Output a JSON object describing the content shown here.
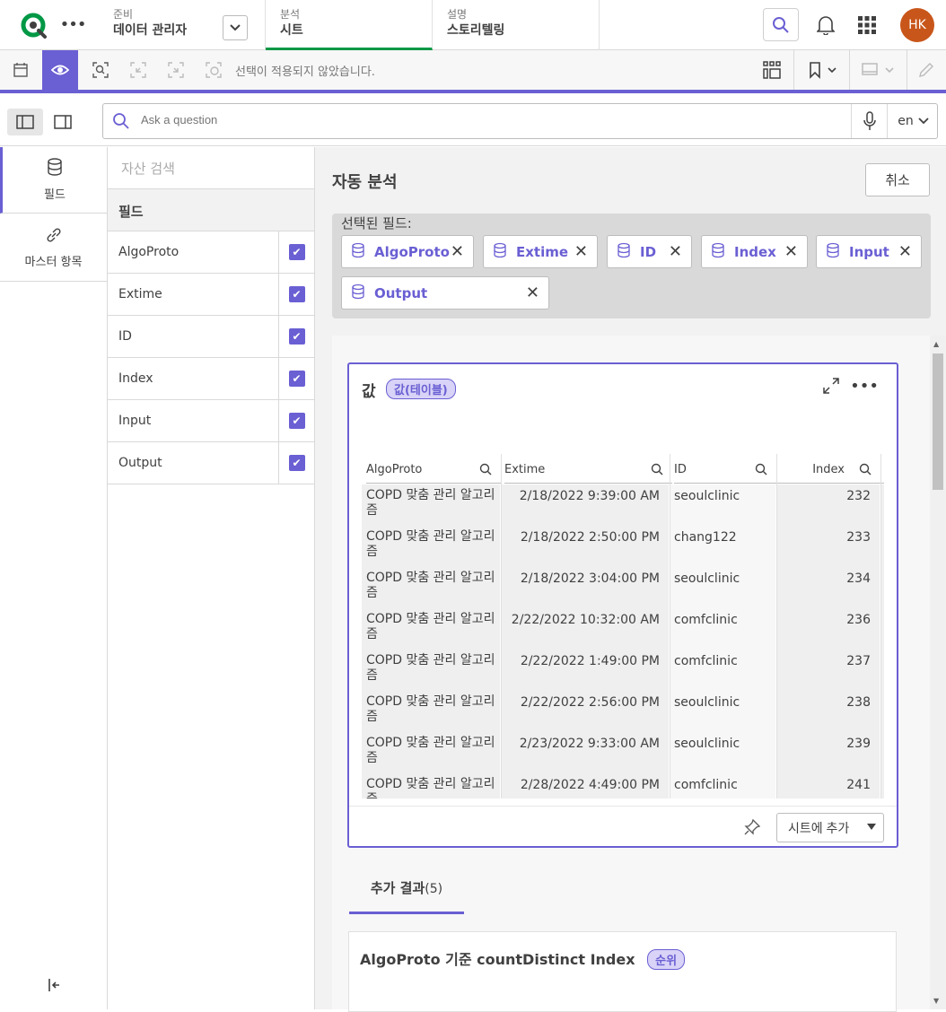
{
  "topnav": {
    "prep_small": "준비",
    "prep_big": "데이터 관리자",
    "analysis_small": "분석",
    "analysis_big": "시트",
    "story_small": "설명",
    "story_big": "스토리텔링",
    "avatar_initials": "HK"
  },
  "toolbar": {
    "selection_message": "선택이 적용되지 않았습니다."
  },
  "question": {
    "placeholder": "Ask a question",
    "language": "en"
  },
  "rail": {
    "fields_label": "필드",
    "master_label": "마스터 항목"
  },
  "fields_panel": {
    "search_placeholder": "자산 검색",
    "header": "필드",
    "fields": [
      "AlgoProto",
      "Extime",
      "ID",
      "Index",
      "Input",
      "Output"
    ]
  },
  "main": {
    "title": "자동 분석",
    "cancel_label": "취소",
    "selected_label": "선택된 필드:",
    "chips": [
      "AlgoProto",
      "Extime",
      "ID",
      "Index",
      "Input",
      "Output"
    ]
  },
  "card": {
    "title": "값",
    "badge": "값(테이블)",
    "columns": [
      "AlgoProto",
      "Extime",
      "ID",
      "Index"
    ],
    "rows": [
      [
        "COPD 맞춤 관리 알고리즘",
        "2/18/2022 9:39:00 AM",
        "seoulclinic",
        "232"
      ],
      [
        "COPD 맞춤 관리 알고리즘",
        "2/18/2022 2:50:00 PM",
        "chang122",
        "233"
      ],
      [
        "COPD 맞춤 관리 알고리즘",
        "2/18/2022 3:04:00 PM",
        "seoulclinic",
        "234"
      ],
      [
        "COPD 맞춤 관리 알고리즘",
        "2/22/2022 10:32:00 AM",
        "comfclinic",
        "236"
      ],
      [
        "COPD 맞춤 관리 알고리즘",
        "2/22/2022 1:49:00 PM",
        "comfclinic",
        "237"
      ],
      [
        "COPD 맞춤 관리 알고리즘",
        "2/22/2022 2:56:00 PM",
        "seoulclinic",
        "238"
      ],
      [
        "COPD 맞춤 관리 알고리즘",
        "2/23/2022 9:33:00 AM",
        "seoulclinic",
        "239"
      ],
      [
        "COPD 맞춤 관리 알고리즘",
        "2/28/2022 4:49:00 PM",
        "comfclinic",
        "241"
      ]
    ],
    "add_to_sheet": "시트에 추가"
  },
  "more_results": {
    "label": "추가 결과",
    "count": "(5)"
  },
  "card2": {
    "title": "AlgoProto 기준 countDistinct Index",
    "badge": "순위"
  },
  "colors": {
    "accent": "#6a5fd3",
    "qlik_green": "#009845",
    "avatar": "#c8561a"
  }
}
